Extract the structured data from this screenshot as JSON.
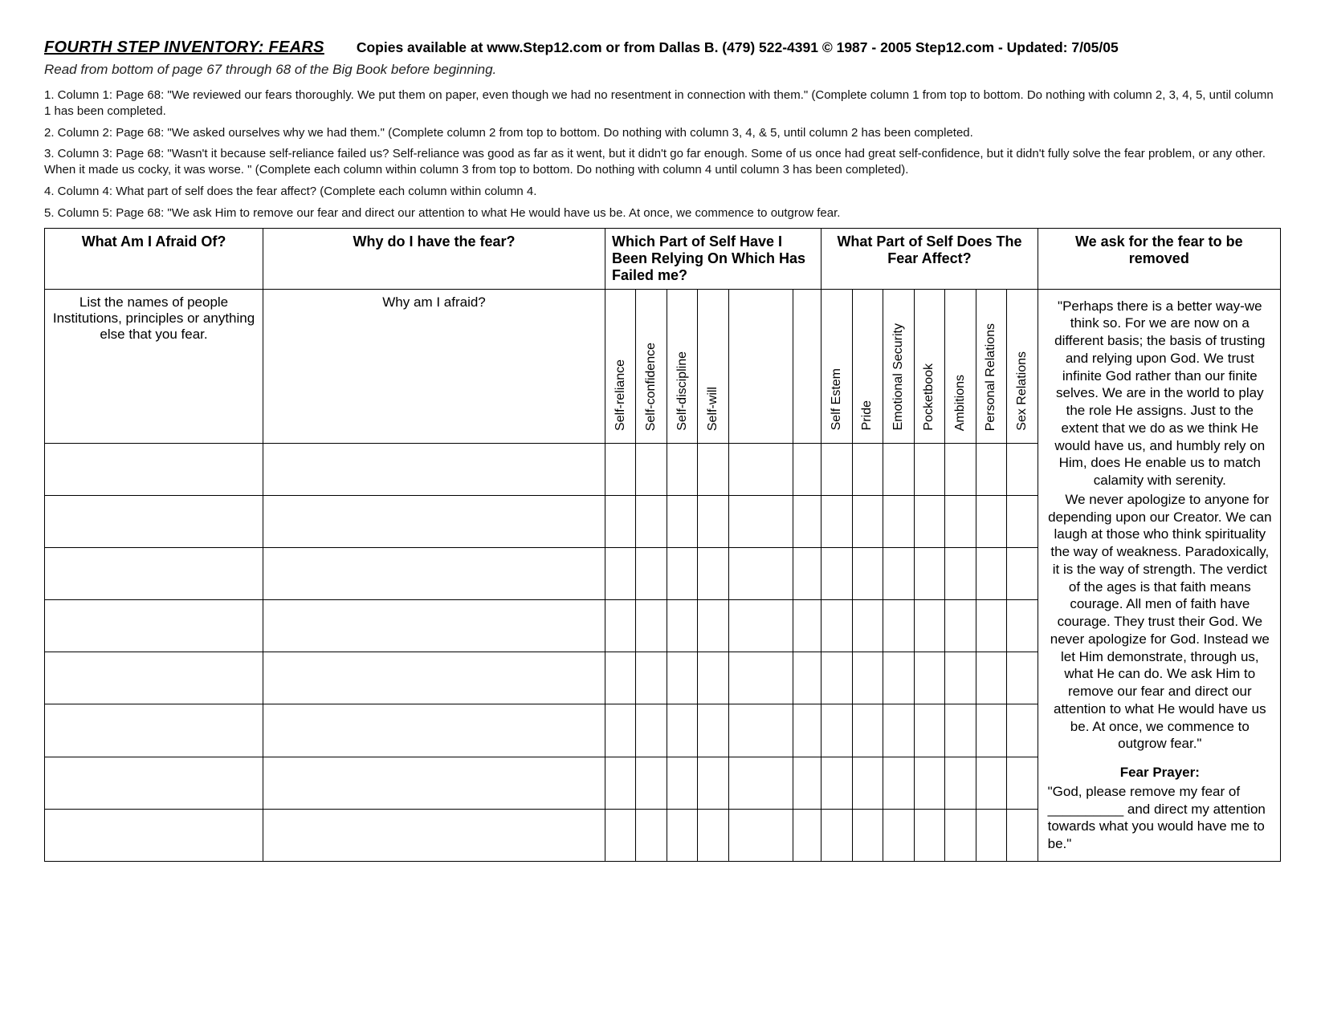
{
  "header": {
    "title": "FOURTH STEP INVENTORY:    FEARS",
    "right": "Copies available at www.Step12.com or from Dallas B.  (479) 522-4391   ©  1987 - 2005  Step12.com - Updated: 7/05/05",
    "subtitle": "Read from bottom of page 67 through  68  of the Big Book before beginning."
  },
  "instructions": [
    "1.  Column 1: Page 68: \"We reviewed our fears thoroughly.  We put them on paper, even though we had no resentment in connection with them.\"  (Complete column 1 from top to bottom.  Do nothing with column 2, 3, 4, 5, until column 1 has been completed.",
    "2.  Column 2: Page 68: \"We asked ourselves why we had them.\"  (Complete column 2 from top to bottom. Do nothing with column 3, 4, & 5,  until column 2 has been completed.",
    "3.  Column 3: Page 68: \"Wasn't it because self-reliance failed us?  Self-reliance was good as far as it went, but it didn't go far enough.  Some of us once had great self-confidence, but it didn't fully solve the fear problem, or any other.  When it made us cocky, it was worse. \"  (Complete each column within column 3 from top to bottom. Do nothing with column 4 until column 3 has been completed).",
    "4. Column 4:  What part of self does the fear affect? (Complete each column within column 4.",
    "5.  Column 5: Page 68: \"We ask Him to remove our fear and direct our attention to what He would have us be.  At once, we commence to outgrow fear."
  ],
  "columns": {
    "group_headers": [
      "What Am I Afraid Of?",
      "Why do I have the fear?",
      "Which Part of Self Have I Been Relying On Which Has Failed me?",
      "What Part of Self Does The Fear Affect?",
      "We ask for the fear to be removed"
    ],
    "sub1": "List the names of people Institutions,  principles or anything else that you fear.",
    "sub2": "Why am I afraid?",
    "self_reliance_cols": [
      "Self-reliance",
      "Self-confidence",
      "Self-discipline",
      "Self-will"
    ],
    "affect_cols": [
      "Self Estem",
      "Pride",
      "Emotional  Security",
      "Pocketbook",
      "Ambitions",
      "Personal Relations",
      "Sex Relations"
    ]
  },
  "sidebar": {
    "para1": "\"Perhaps there is a better way-we think so.  For we are now on a different basis; the basis of trusting and relying upon God.  We trust infinite God rather than our finite selves.  We are in the world to play the role He assigns.  Just to the extent that we do as we think He would have us, and humbly rely on Him, does He enable us to match calamity with serenity.",
    "para2": "We never apologize to anyone for depending upon our Creator.  We can laugh at those who think spirituality the way of weakness.  Paradoxically, it is the way of strength.  The verdict of the ages is that faith means courage.  All men of faith have courage.  They trust their God.  We never apologize for God.  Instead we let Him demonstrate, through us, what He can do.  We ask Him to remove our fear and direct our attention to what He would have us be.  At once, we commence to outgrow fear.\"",
    "prayer_title": "Fear Prayer:",
    "prayer": "\"God, please remove my fear of __________ and direct my attention towards what you would have me to be.\""
  }
}
